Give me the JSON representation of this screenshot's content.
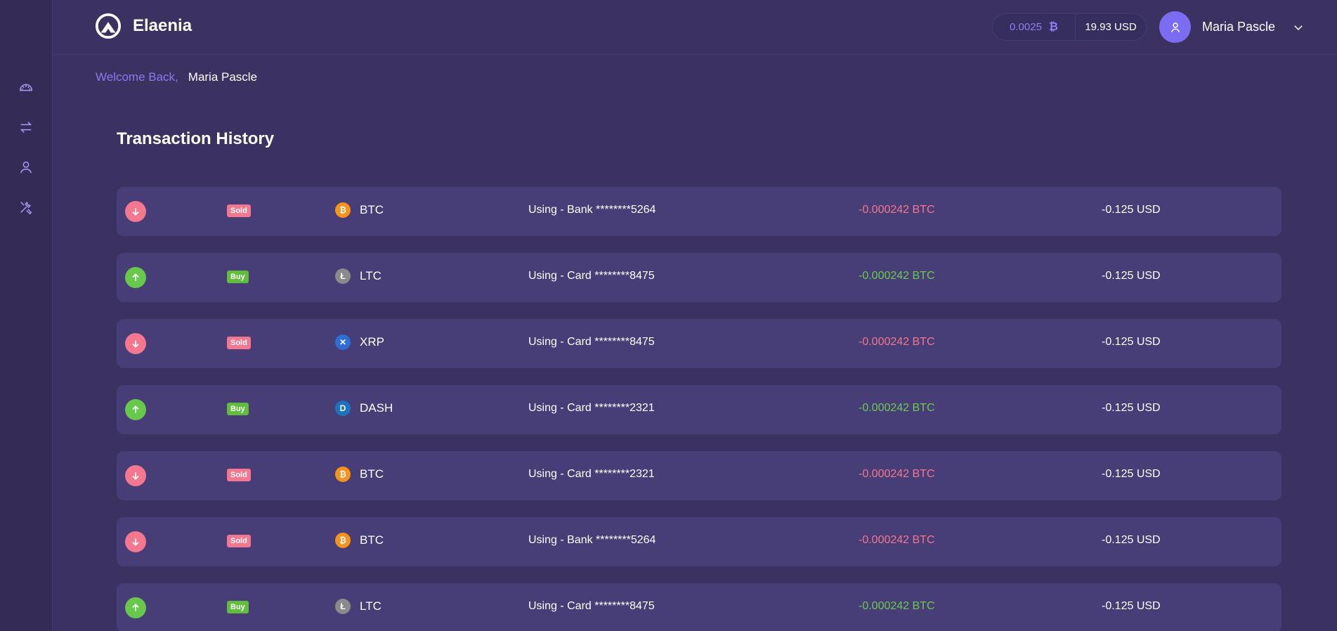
{
  "brand": {
    "name": "Elaenia"
  },
  "balance": {
    "btc": "0.0025",
    "usd": "19.93 USD"
  },
  "user": {
    "name": "Maria Pascle"
  },
  "welcome": {
    "label": "Welcome Back,",
    "name": "Maria Pascle"
  },
  "section": {
    "title": "Transaction History"
  },
  "sidebar": {
    "items": [
      {
        "icon": "dashboard-gauge-icon"
      },
      {
        "icon": "exchange-arrows-icon"
      },
      {
        "icon": "user-icon"
      },
      {
        "icon": "tools-icon"
      }
    ]
  },
  "colors": {
    "background": "#3b3262",
    "row": "#473d77",
    "accent": "#7b6cf1",
    "sold": "#f2778f",
    "buy": "#62bd3c"
  },
  "transactions": [
    {
      "direction": "down",
      "type": "Sold",
      "coin": "BTC",
      "coin_icon": "bitcoin-icon",
      "method": "Using - Bank ********5264",
      "amount_btc": "-0.000242 BTC",
      "amount_usd": "-0.125 USD"
    },
    {
      "direction": "up",
      "type": "Buy",
      "coin": "LTC",
      "coin_icon": "litecoin-icon",
      "method": "Using - Card ********8475",
      "amount_btc": "-0.000242 BTC",
      "amount_usd": "-0.125 USD"
    },
    {
      "direction": "down",
      "type": "Sold",
      "coin": "XRP",
      "coin_icon": "ripple-icon",
      "method": "Using - Card ********8475",
      "amount_btc": "-0.000242 BTC",
      "amount_usd": "-0.125 USD"
    },
    {
      "direction": "up",
      "type": "Buy",
      "coin": "DASH",
      "coin_icon": "dash-icon",
      "method": "Using - Card ********2321",
      "amount_btc": "-0.000242 BTC",
      "amount_usd": "-0.125 USD"
    },
    {
      "direction": "down",
      "type": "Sold",
      "coin": "BTC",
      "coin_icon": "bitcoin-icon",
      "method": "Using - Card ********2321",
      "amount_btc": "-0.000242 BTC",
      "amount_usd": "-0.125 USD"
    },
    {
      "direction": "down",
      "type": "Sold",
      "coin": "BTC",
      "coin_icon": "bitcoin-icon",
      "method": "Using - Bank ********5264",
      "amount_btc": "-0.000242 BTC",
      "amount_usd": "-0.125 USD"
    },
    {
      "direction": "up",
      "type": "Buy",
      "coin": "LTC",
      "coin_icon": "litecoin-icon",
      "method": "Using - Card ********8475",
      "amount_btc": "-0.000242 BTC",
      "amount_usd": "-0.125 USD"
    }
  ]
}
